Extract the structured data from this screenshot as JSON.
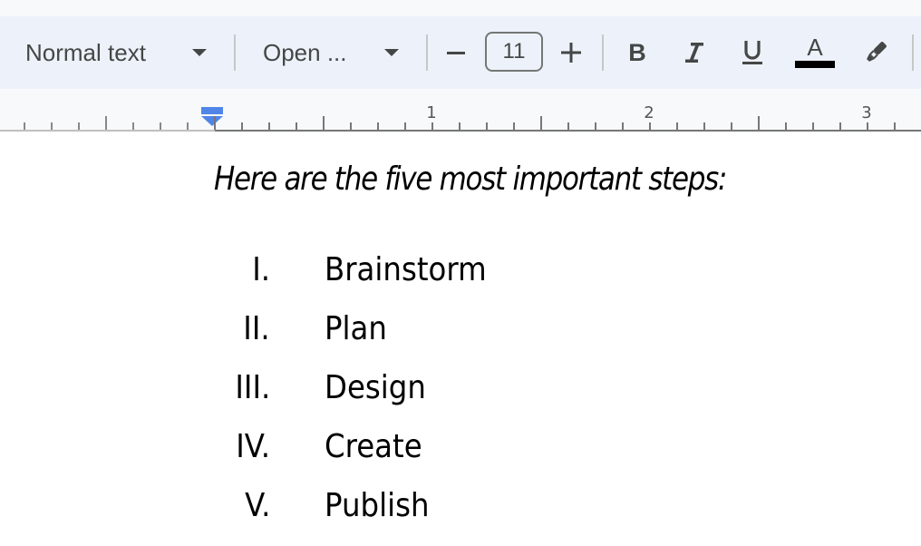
{
  "toolbar": {
    "style_select": "Normal text",
    "font_select": "Open ...",
    "decrease_font_label": "−",
    "font_size": "11",
    "increase_font_label": "+",
    "bold_label": "B",
    "italic_label": "I",
    "underline_label": "U",
    "text_color_label": "A",
    "text_color": "#000000"
  },
  "ruler": {
    "numbers": [
      "1",
      "2",
      "3"
    ]
  },
  "document": {
    "intro": "Here are the five most important steps:",
    "list": [
      {
        "numeral": "I.",
        "text": "Brainstorm"
      },
      {
        "numeral": "II.",
        "text": "Plan"
      },
      {
        "numeral": "III.",
        "text": "Design"
      },
      {
        "numeral": "IV.",
        "text": "Create"
      },
      {
        "numeral": "V.",
        "text": "Publish"
      }
    ]
  }
}
